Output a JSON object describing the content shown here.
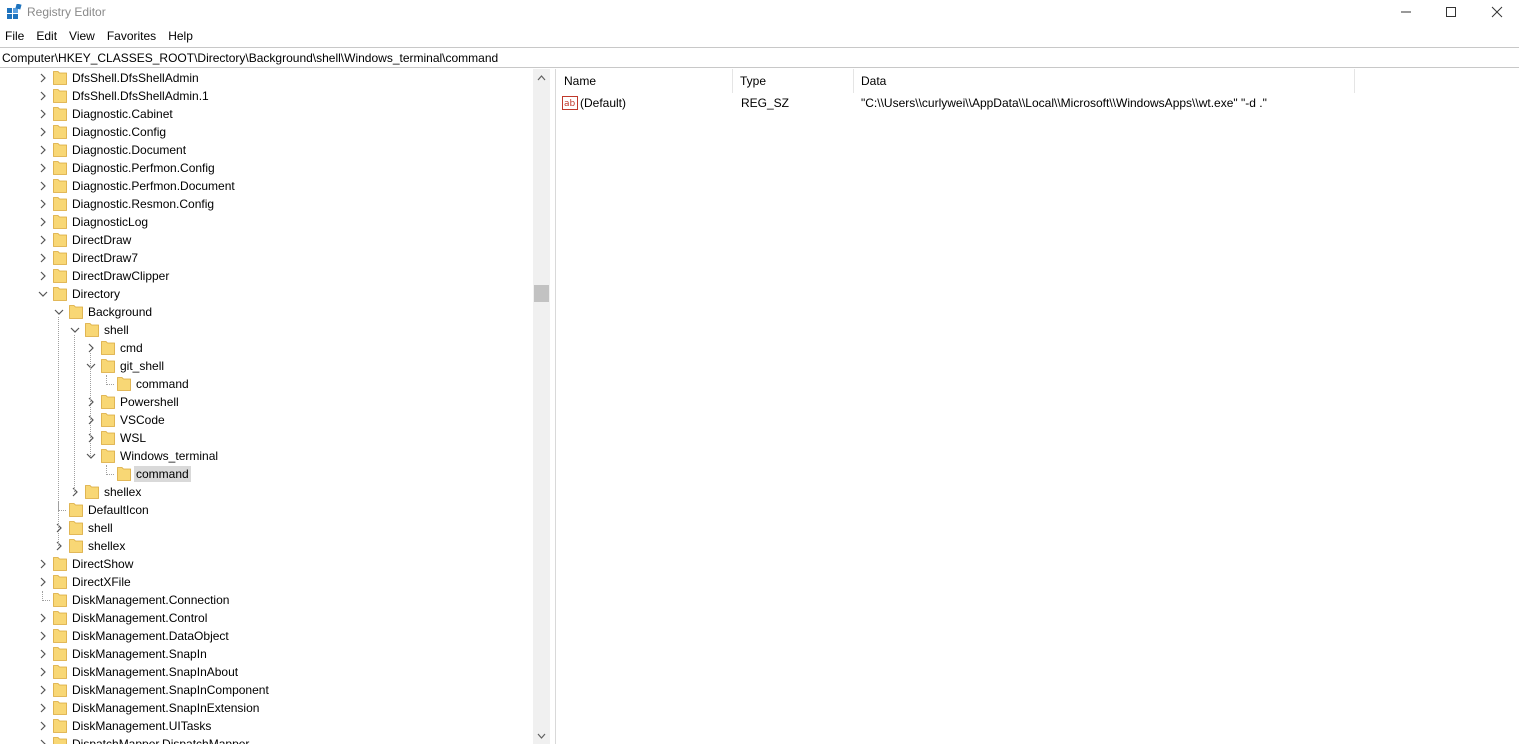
{
  "window": {
    "title": "Registry Editor"
  },
  "menu": [
    "File",
    "Edit",
    "View",
    "Favorites",
    "Help"
  ],
  "address": "Computer\\HKEY_CLASSES_ROOT\\Directory\\Background\\shell\\Windows_terminal\\command",
  "tree": [
    {
      "label": "DfsShell.DfsShellAdmin",
      "level": 0,
      "state": "collapsed"
    },
    {
      "label": "DfsShell.DfsShellAdmin.1",
      "level": 0,
      "state": "collapsed"
    },
    {
      "label": "Diagnostic.Cabinet",
      "level": 0,
      "state": "collapsed"
    },
    {
      "label": "Diagnostic.Config",
      "level": 0,
      "state": "collapsed"
    },
    {
      "label": "Diagnostic.Document",
      "level": 0,
      "state": "collapsed"
    },
    {
      "label": "Diagnostic.Perfmon.Config",
      "level": 0,
      "state": "collapsed"
    },
    {
      "label": "Diagnostic.Perfmon.Document",
      "level": 0,
      "state": "collapsed"
    },
    {
      "label": "Diagnostic.Resmon.Config",
      "level": 0,
      "state": "collapsed"
    },
    {
      "label": "DiagnosticLog",
      "level": 0,
      "state": "collapsed"
    },
    {
      "label": "DirectDraw",
      "level": 0,
      "state": "collapsed"
    },
    {
      "label": "DirectDraw7",
      "level": 0,
      "state": "collapsed"
    },
    {
      "label": "DirectDrawClipper",
      "level": 0,
      "state": "collapsed"
    },
    {
      "label": "Directory",
      "level": 0,
      "state": "expanded"
    },
    {
      "label": "Background",
      "level": 1,
      "state": "expanded"
    },
    {
      "label": "shell",
      "level": 2,
      "state": "expanded"
    },
    {
      "label": "cmd",
      "level": 3,
      "state": "collapsed"
    },
    {
      "label": "git_shell",
      "level": 3,
      "state": "expanded"
    },
    {
      "label": "command",
      "level": 4,
      "state": "leaf"
    },
    {
      "label": "Powershell",
      "level": 3,
      "state": "collapsed"
    },
    {
      "label": "VSCode",
      "level": 3,
      "state": "collapsed"
    },
    {
      "label": "WSL",
      "level": 3,
      "state": "collapsed"
    },
    {
      "label": "Windows_terminal",
      "level": 3,
      "state": "expanded"
    },
    {
      "label": "command",
      "level": 4,
      "state": "leaf",
      "selected": true
    },
    {
      "label": "shellex",
      "level": 2,
      "state": "collapsed"
    },
    {
      "label": "DefaultIcon",
      "level": 1,
      "state": "leaf"
    },
    {
      "label": "shell",
      "level": 1,
      "state": "collapsed"
    },
    {
      "label": "shellex",
      "level": 1,
      "state": "collapsed"
    },
    {
      "label": "DirectShow",
      "level": 0,
      "state": "collapsed"
    },
    {
      "label": "DirectXFile",
      "level": 0,
      "state": "collapsed"
    },
    {
      "label": "DiskManagement.Connection",
      "level": 0,
      "state": "leaf"
    },
    {
      "label": "DiskManagement.Control",
      "level": 0,
      "state": "collapsed"
    },
    {
      "label": "DiskManagement.DataObject",
      "level": 0,
      "state": "collapsed"
    },
    {
      "label": "DiskManagement.SnapIn",
      "level": 0,
      "state": "collapsed"
    },
    {
      "label": "DiskManagement.SnapInAbout",
      "level": 0,
      "state": "collapsed"
    },
    {
      "label": "DiskManagement.SnapInComponent",
      "level": 0,
      "state": "collapsed"
    },
    {
      "label": "DiskManagement.SnapInExtension",
      "level": 0,
      "state": "collapsed"
    },
    {
      "label": "DiskManagement.UITasks",
      "level": 0,
      "state": "collapsed"
    },
    {
      "label": "DispatchMapper.DispatchMapper",
      "level": 0,
      "state": "collapsed"
    }
  ],
  "list": {
    "columns": {
      "name": "Name",
      "type": "Type",
      "data": "Data"
    },
    "rows": [
      {
        "name": "(Default)",
        "type": "REG_SZ",
        "data": "\"C:\\\\Users\\\\curlywei\\\\AppData\\\\Local\\\\Microsoft\\\\WindowsApps\\\\wt.exe\" \"-d .\"",
        "icon": "string-value-icon"
      }
    ]
  },
  "colors": {
    "folder": "#f8d775",
    "folder_edge": "#d9a83a",
    "selection": "#d9d9d9",
    "string_icon": "#c0392b"
  }
}
